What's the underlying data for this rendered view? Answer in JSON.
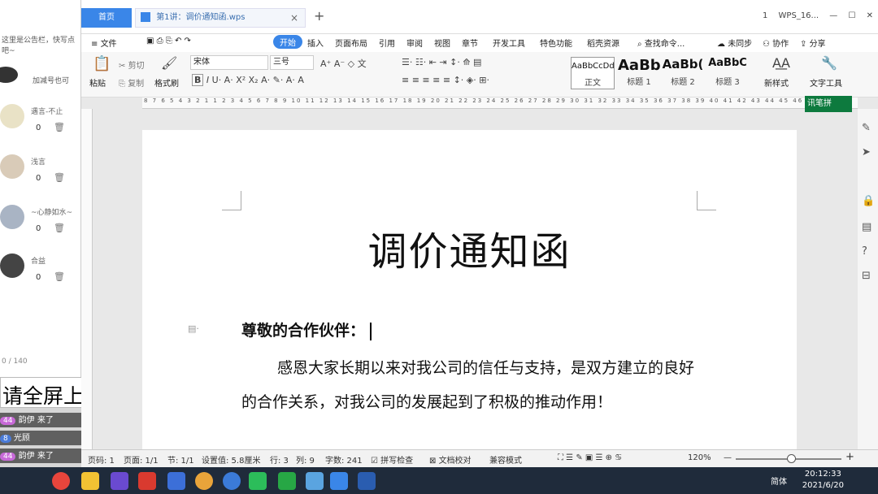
{
  "chat": {
    "notice": "这里是公告栏，快写点吧~",
    "hint": "加减号也可",
    "rows": [
      {
        "name": "遇言-不止",
        "count": "0"
      },
      {
        "name": "浅言",
        "count": "0"
      },
      {
        "name": "~心静如水~",
        "count": "0"
      },
      {
        "name": "合益",
        "count": "0"
      }
    ],
    "char_counter": "0 / 140",
    "banner": "请全屏上课",
    "live": [
      {
        "level": "44",
        "name": "韵伊",
        "msg": "来了"
      },
      {
        "level": "8",
        "name": "光顾",
        "msg": ""
      },
      {
        "level": "44",
        "name": "韵伊",
        "msg": "来了"
      }
    ]
  },
  "tabs": {
    "home": "首页",
    "doc": "第1讲：调价通知函.wps",
    "close": "×",
    "plus": "+",
    "right": [
      "1",
      "WPS_16..."
    ]
  },
  "menu": {
    "file": "文件",
    "items": [
      "开始",
      "插入",
      "页面布局",
      "引用",
      "审阅",
      "视图",
      "章节",
      "开发工具",
      "特色功能",
      "稻壳资源"
    ],
    "search": "查找命令...",
    "sync": "未同步",
    "collab": "协作",
    "share": "分享"
  },
  "ribbon": {
    "paste": "粘贴",
    "cut": "剪切",
    "copy": "复制",
    "format_painter": "格式刷",
    "font": "宋体",
    "size": "三号",
    "styles": [
      {
        "preview": "AaBbCcDd",
        "caption": "正文"
      },
      {
        "preview": "AaBb",
        "caption": "标题 1"
      },
      {
        "preview": "AaBb(",
        "caption": "标题 2"
      },
      {
        "preview": "AaBbC",
        "caption": "标题 3"
      }
    ],
    "new_style": "新样式",
    "text_tools": "文字工具"
  },
  "ruler": "8 7 6 5 4 3 2 1 1 2 3 4 5 6 7 8 9 10 11 12 13 14 15 16 17 18 19 20 21 22 23 24 25 26 27 28 29 30 31 32 33 34 35 36 37 38 39 40 41 42 43 44 45 46 47",
  "ime": "讯笔拼",
  "document": {
    "title": "调价通知函",
    "salutation": "尊敬的合作伙伴：",
    "body": "感恩大家长期以来对我公司的信任与支持，是双方建立的良好的合作关系，对我公司的发展起到了积极的推动作用！"
  },
  "status": {
    "page": "页码: 1",
    "pages": "页面: 1/1",
    "section": "节: 1/1",
    "setting": "设置值: 5.8厘米",
    "row": "行: 3",
    "col": "列: 9",
    "words": "字数: 241",
    "spell": "拼写检查",
    "proof": "文档校对",
    "compat": "兼容模式",
    "zoom": "120%"
  },
  "taskbar": {
    "lang": "简体",
    "time": "20:12:33",
    "date": "2021/6/20"
  },
  "colors": {
    "accent": "#3a86e8",
    "taskbar": "#1f2b3b"
  }
}
